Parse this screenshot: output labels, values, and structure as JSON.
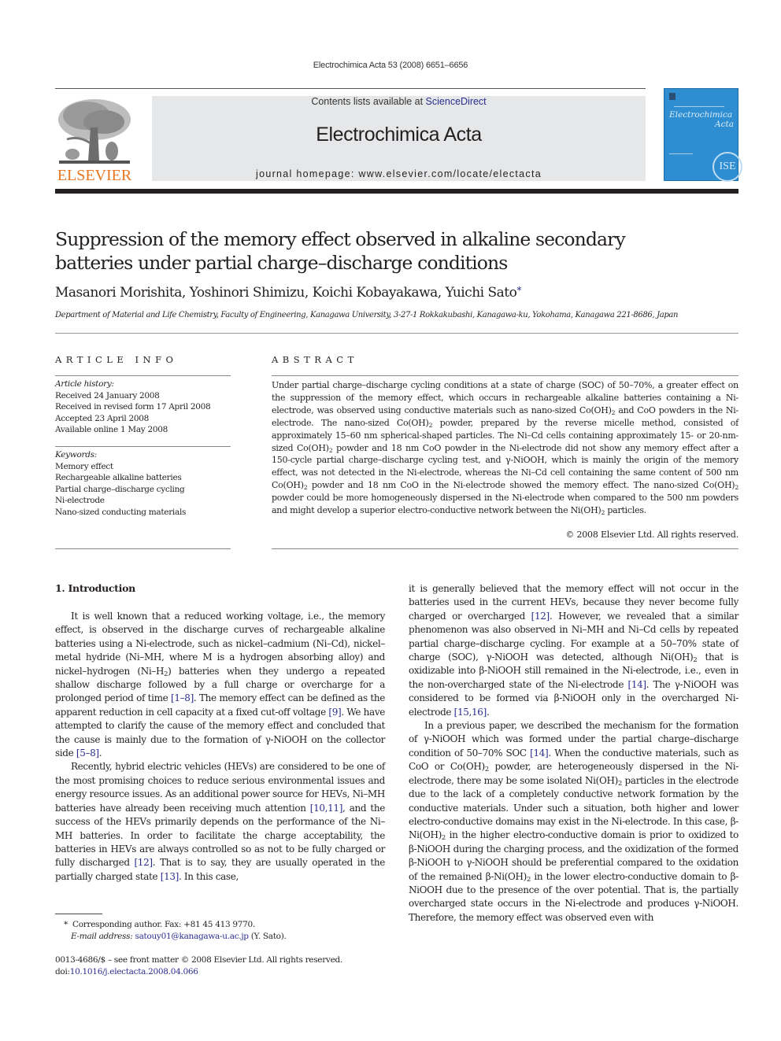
{
  "running_head": "Electrochimica Acta 53 (2008) 6651–6656",
  "masthead": {
    "publisher_wordmark": "ELSEVIER",
    "contents_prefix": "Contents lists available at ",
    "contents_link": "ScienceDirect",
    "journal_name": "Electrochimica Acta",
    "homepage_line": "journal homepage: www.elsevier.com/locate/electacta",
    "cover": {
      "title_line1": "Electrochimica",
      "title_line2": "Acta",
      "seal": "ISE"
    },
    "colors": {
      "publisher_orange": "#e87722",
      "banner_gray": "#e6e7e8",
      "cover_blue": "#2f8ed1",
      "link_blue": "#2b2d8e"
    }
  },
  "article": {
    "title": "Suppression of the memory effect observed in alkaline secondary batteries under partial charge–discharge conditions",
    "authors": "Masanori Morishita, Yoshinori Shimizu, Koichi Kobayakawa, Yuichi Sato",
    "corresponding_marker": "*",
    "affiliation": "Department of Material and Life Chemistry, Faculty of Engineering, Kanagawa University, 3-27-1 Rokkakubashi, Kanagawa-ku, Yokohama, Kanagawa 221-8686, Japan"
  },
  "article_info": {
    "heading": "ARTICLE INFO",
    "history_label": "Article history:",
    "history": [
      "Received 24 January 2008",
      "Received in revised form 17 April 2008",
      "Accepted 23 April 2008",
      "Available online 1 May 2008"
    ],
    "keywords_label": "Keywords:",
    "keywords": [
      "Memory effect",
      "Rechargeable alkaline batteries",
      "Partial charge–discharge cycling",
      "Ni-electrode",
      "Nano-sized conducting materials"
    ]
  },
  "abstract": {
    "heading": "ABSTRACT",
    "parts": [
      "Under partial charge–discharge cycling conditions at a state of charge (SOC) of 50–70%, a greater effect on the suppression of the memory effect, which occurs in rechargeable alkaline batteries containing a Ni-electrode, was observed using conductive materials such as nano-sized Co(OH)",
      "2",
      " and CoO powders in the Ni-electrode. The nano-sized Co(OH)",
      "2",
      " powder, prepared by the reverse micelle method, consisted of approximately 15–60 nm spherical-shaped particles. The Ni–Cd cells containing approximately 15- or 20-nm-sized Co(OH)",
      "2",
      " powder and 18 nm CoO powder in the Ni-electrode did not show any memory effect after a 150-cycle partial charge–discharge cycling test, and γ-NiOOH, which is mainly the origin of the memory effect, was not detected in the Ni-electrode, whereas the Ni–Cd cell containing the same content of 500 nm Co(OH)",
      "2",
      " powder and 18 nm CoO in the Ni-electrode showed the memory effect. The nano-sized Co(OH)",
      "2",
      " powder could be more homogeneously dispersed in the Ni-electrode when compared to the 500 nm powders and might develop a superior electro-conductive network between the Ni(OH)",
      "2",
      " particles."
    ],
    "copyright": "© 2008 Elsevier Ltd. All rights reserved."
  },
  "introduction": {
    "heading": "1.  Introduction",
    "p1": {
      "a": "It is well known that a reduced working voltage, i.e., the memory effect, is observed in the discharge curves of rechargeable alkaline batteries using a Ni-electrode, such as nickel–cadmium (Ni–Cd), nickel–metal hydride (Ni–MH, where M is a hydrogen absorbing alloy) and nickel–hydrogen (Ni–H",
      "sub": "2",
      "b": ") batteries when they undergo a repeated shallow discharge followed by a full charge or overcharge for a prolonged period of time ",
      "ref1": "[1–8]",
      "c": ". The memory effect can be defined as the apparent reduction in cell capacity at a fixed cut-off voltage ",
      "ref2": "[9]",
      "d": ". We have attempted to clarify the cause of the memory effect and concluded that the cause is mainly due to the formation of γ-NiOOH on the collector side ",
      "ref3": "[5–8]",
      "e": "."
    },
    "p2": {
      "a": "Recently, hybrid electric vehicles (HEVs) are considered to be one of the most promising choices to reduce serious environmental issues and energy resource issues. As an additional power source for HEVs, Ni–MH batteries have already been receiving much attention ",
      "ref1": "[10,11]",
      "b": ", and the success of the HEVs primarily depends on the performance of the Ni–MH batteries. In order to facilitate the charge acceptability, the batteries in HEVs are always controlled so as not to be fully charged or fully discharged ",
      "ref2": "[12]",
      "c": ". That is to say, they are usually operated in the partially charged state ",
      "ref3": "[13]",
      "d": ". In this case, it is generally believed that the memory effect will not occur in the batteries used in the current HEVs, because they never become fully charged or overcharged ",
      "ref4": "[12]",
      "e": ". However, we revealed that a similar phenomenon was also observed in Ni–MH and Ni–Cd cells by repeated partial charge–discharge cycling. For example at a 50–70% state of charge (SOC), γ-NiOOH was detected, although Ni(OH)",
      "sub": "2",
      "f": " that is oxidizable into β-NiOOH still remained in the Ni-electrode, i.e., even in the non-overcharged state of the Ni-electrode ",
      "ref5": "[14]",
      "g": ". The γ-NiOOH was considered to be formed via β-NiOOH only in the overcharged Ni-electrode ",
      "ref6": "[15,16]",
      "h": "."
    },
    "p3": {
      "a": "In a previous paper, we described the mechanism for the formation of γ-NiOOH which was formed under the partial charge–discharge condition of 50–70% SOC ",
      "ref1": "[14]",
      "b": ". When the conductive materials, such as CoO or Co(OH)",
      "sub1": "2",
      "c": " powder, are heterogeneously dispersed in the Ni-electrode, there may be some isolated Ni(OH)",
      "sub2": "2",
      "d": " particles in the electrode due to the lack of a completely conductive network formation by the conductive materials. Under such a situation, both higher and lower electro-conductive domains may exist in the Ni-electrode. In this case, β-Ni(OH)",
      "sub3": "2",
      "e": " in the higher electro-conductive domain is prior to oxidized to β-NiOOH during the charging process, and the oxidization of the formed β-NiOOH to γ-NiOOH should be preferential compared to the oxidation of the remained β-Ni(OH)",
      "sub4": "2",
      "f": " in the lower electro-conductive domain to β-NiOOH due to the presence of the over potential. That is, the partially overcharged state occurs in the Ni-electrode and produces γ-NiOOH. Therefore, the memory effect was observed even with"
    }
  },
  "footnote": {
    "marker": "*",
    "corresponding": "Corresponding author. Fax: +81 45 413 9770.",
    "email_label": "E-mail address:",
    "email": "satouy01@kanagawa-u.ac.jp",
    "email_suffix": " (Y. Sato)."
  },
  "front_matter": {
    "issn_line": "0013-4686/$ – see front matter © 2008 Elsevier Ltd. All rights reserved.",
    "doi_label": "doi:",
    "doi": "10.1016/j.electacta.2008.04.066"
  }
}
